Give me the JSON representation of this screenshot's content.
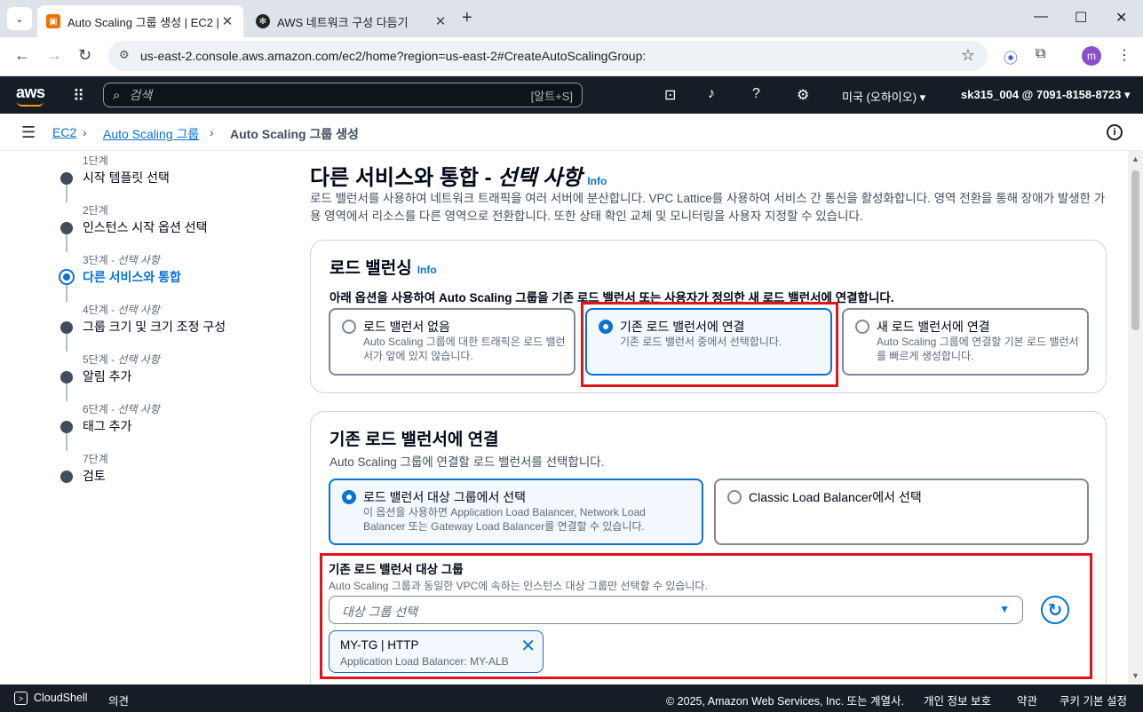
{
  "browser": {
    "tabs": [
      {
        "title": "Auto Scaling 그룹 생성 | EC2 |",
        "active": true
      },
      {
        "title": "AWS 네트워크 구성 다듬기",
        "active": false
      }
    ],
    "url": "us-east-2.console.aws.amazon.com/ec2/home?region=us-east-2#CreateAutoScalingGroup:",
    "profile_initial": "m"
  },
  "aws_nav": {
    "logo": "aws",
    "search_placeholder": "검색",
    "search_shortcut": "[알트+S]",
    "region": "미국 (오하이오) ▾",
    "account": "sk315_004 @ 7091-8158-8723 ▾"
  },
  "breadcrumbs": [
    {
      "label": "EC2",
      "link": true
    },
    {
      "label": "Auto Scaling 그룹",
      "link": true
    },
    {
      "label": "Auto Scaling 그룹 생성",
      "link": false
    }
  ],
  "steps": [
    {
      "num": "1단계",
      "optional": "",
      "label": "시작 템플릿 선택"
    },
    {
      "num": "2단계",
      "optional": "",
      "label": "인스턴스 시작 옵션 선택"
    },
    {
      "num": "3단계 - ",
      "optional": "선택 사항",
      "label": "다른 서비스와 통합"
    },
    {
      "num": "4단계 - ",
      "optional": "선택 사항",
      "label": "그룹 크기 및 크기 조정 구성"
    },
    {
      "num": "5단계 - ",
      "optional": "선택 사항",
      "label": "알림 추가"
    },
    {
      "num": "6단계 - ",
      "optional": "선택 사항",
      "label": "태그 추가"
    },
    {
      "num": "7단계",
      "optional": "",
      "label": "검토"
    }
  ],
  "page": {
    "title": "다른 서비스와 통합 - ",
    "title_optional": "선택 사항",
    "info": "Info",
    "description": "로드 밸런서를 사용하여 네트워크 트래픽을 여러 서버에 분산합니다. VPC Lattice를 사용하여 서비스 간 통신을 활성화합니다. 영역 전환을 통해 장애가 발생한 가용 영역에서 리소스를 다른 영역으로 전환합니다. 또한 상태 확인 교체 및 모니터링을 사용자 지정할 수 있습니다."
  },
  "load_balancing": {
    "heading": "로드 밸런싱",
    "info": "Info",
    "instruction": "아래 옵션을 사용하여 Auto Scaling 그룹을 기존 로드 밸런서 또는 사용자가 정의한 새 로드 밸런서에 연결합니다.",
    "options": [
      {
        "title": "로드 밸런서 없음",
        "desc": "Auto Scaling 그룹에 대한 트래픽은 로드 밸런서가 앞에 있지 않습니다.",
        "selected": false
      },
      {
        "title": "기존 로드 밸런서에 연결",
        "desc": "기존 로드 밸런서 중에서 선택합니다.",
        "selected": true
      },
      {
        "title": "새 로드 밸런서에 연결",
        "desc": "Auto Scaling 그룹에 연결할 기본 로드 밸런서를 빠르게 생성합니다.",
        "selected": false
      }
    ]
  },
  "attach_existing": {
    "heading": "기존 로드 밸런서에 연결",
    "description": "Auto Scaling 그룹에 연결할 로드 밸런서를 선택합니다.",
    "options": [
      {
        "title": "로드 밸런서 대상 그룹에서 선택",
        "desc": "이 옵션을 사용하면 Application Load Balancer, Network Load Balancer 또는 Gateway Load Balancer를 연결할 수 있습니다.",
        "selected": true
      },
      {
        "title": "Classic Load Balancer에서 선택",
        "desc": "",
        "selected": false
      }
    ],
    "target_group_label": "기존 로드 밸런서 대상 그룹",
    "target_group_desc": "Auto Scaling 그룹과 동일한 VPC에 속하는 인스턴스 대상 그룹만 선택할 수 있습니다.",
    "select_placeholder": "대상 그룹 선택",
    "token_title": "MY-TG | HTTP",
    "token_subtitle": "Application Load Balancer: MY-ALB"
  },
  "footer": {
    "cloudshell": "CloudShell",
    "feedback": "의견",
    "copyright": "© 2025, Amazon Web Services, Inc. 또는 계열사.",
    "privacy": "개인 정보 보호",
    "terms": "약관",
    "cookies": "쿠키 기본 설정"
  }
}
